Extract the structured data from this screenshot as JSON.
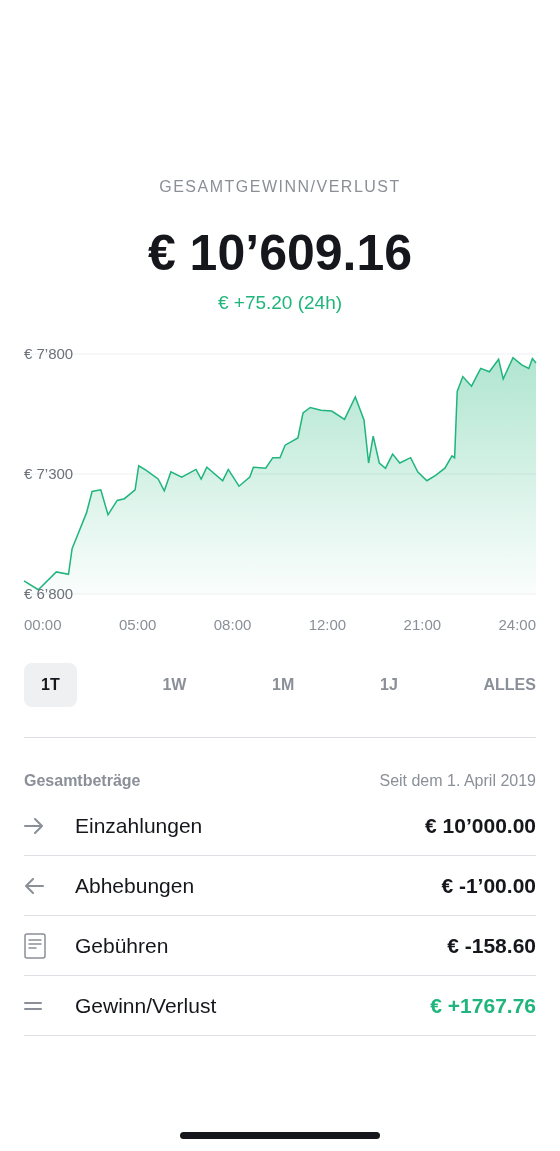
{
  "summary": {
    "title": "GESAMTGEWINN/VERLUST",
    "amount": "€ 10’609.16",
    "change": "€ +75.20 (24h)"
  },
  "chart": {
    "y_labels": [
      "€ 7’800",
      "€ 7’300",
      "€ 6’800"
    ],
    "time_labels": [
      "00:00",
      "05:00",
      "08:00",
      "12:00",
      "21:00",
      "24:00"
    ]
  },
  "ranges": [
    {
      "label": "1T",
      "selected": true
    },
    {
      "label": "1W",
      "selected": false
    },
    {
      "label": "1M",
      "selected": false
    },
    {
      "label": "1J",
      "selected": false
    },
    {
      "label": "ALLES",
      "selected": false
    }
  ],
  "totals": {
    "title": "Gesamtbeträge",
    "since": "Seit dem 1. April 2019",
    "rows": [
      {
        "kind": "deposit",
        "label": "Einzahlungen",
        "value": "€ 10’000.00"
      },
      {
        "kind": "withdrawal",
        "label": "Abhebungen",
        "value": "€ -1’00.00"
      },
      {
        "kind": "fee",
        "label": "Gebühren",
        "value": "€ -158.60"
      },
      {
        "kind": "total",
        "label": "Gewinn/Verlust",
        "value": "€ +1767.76"
      }
    ]
  }
}
